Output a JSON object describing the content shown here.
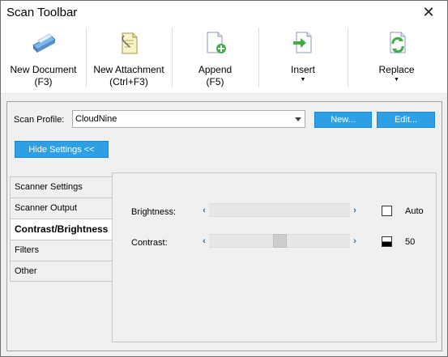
{
  "window": {
    "title": "Scan Toolbar",
    "close_glyph": "✕"
  },
  "toolbar": {
    "buttons": [
      {
        "line1": "New Document",
        "line2": "(F3)",
        "icon": "scanner-icon"
      },
      {
        "line1": "New Attachment",
        "line2": "(Ctrl+F3)",
        "icon": "attachment-icon"
      },
      {
        "line1": "Append",
        "line2": "(F5)",
        "icon": "append-icon"
      },
      {
        "line1": "Insert",
        "arrow": "▼",
        "icon": "insert-icon"
      },
      {
        "line1": "Replace",
        "arrow": "▼",
        "icon": "replace-icon"
      }
    ]
  },
  "profile": {
    "label": "Scan Profile:",
    "value": "CloudNine",
    "new_label": "New...",
    "edit_label": "Edit..."
  },
  "hide_settings_label": "Hide Settings <<",
  "tabs": [
    {
      "label": "Scanner Settings",
      "active": false
    },
    {
      "label": "Scanner Output",
      "active": false
    },
    {
      "label": "Contrast/Brightness",
      "active": true
    },
    {
      "label": "Filters",
      "active": false
    },
    {
      "label": "Other",
      "active": false
    }
  ],
  "brightness": {
    "label": "Brightness:",
    "auto_label": "Auto",
    "auto_checked": false
  },
  "contrast": {
    "label": "Contrast:",
    "value": "50",
    "level": 0.5
  },
  "slider_arrows": {
    "left": "‹",
    "right": "›"
  },
  "colors": {
    "accent": "#2c9fe5"
  }
}
